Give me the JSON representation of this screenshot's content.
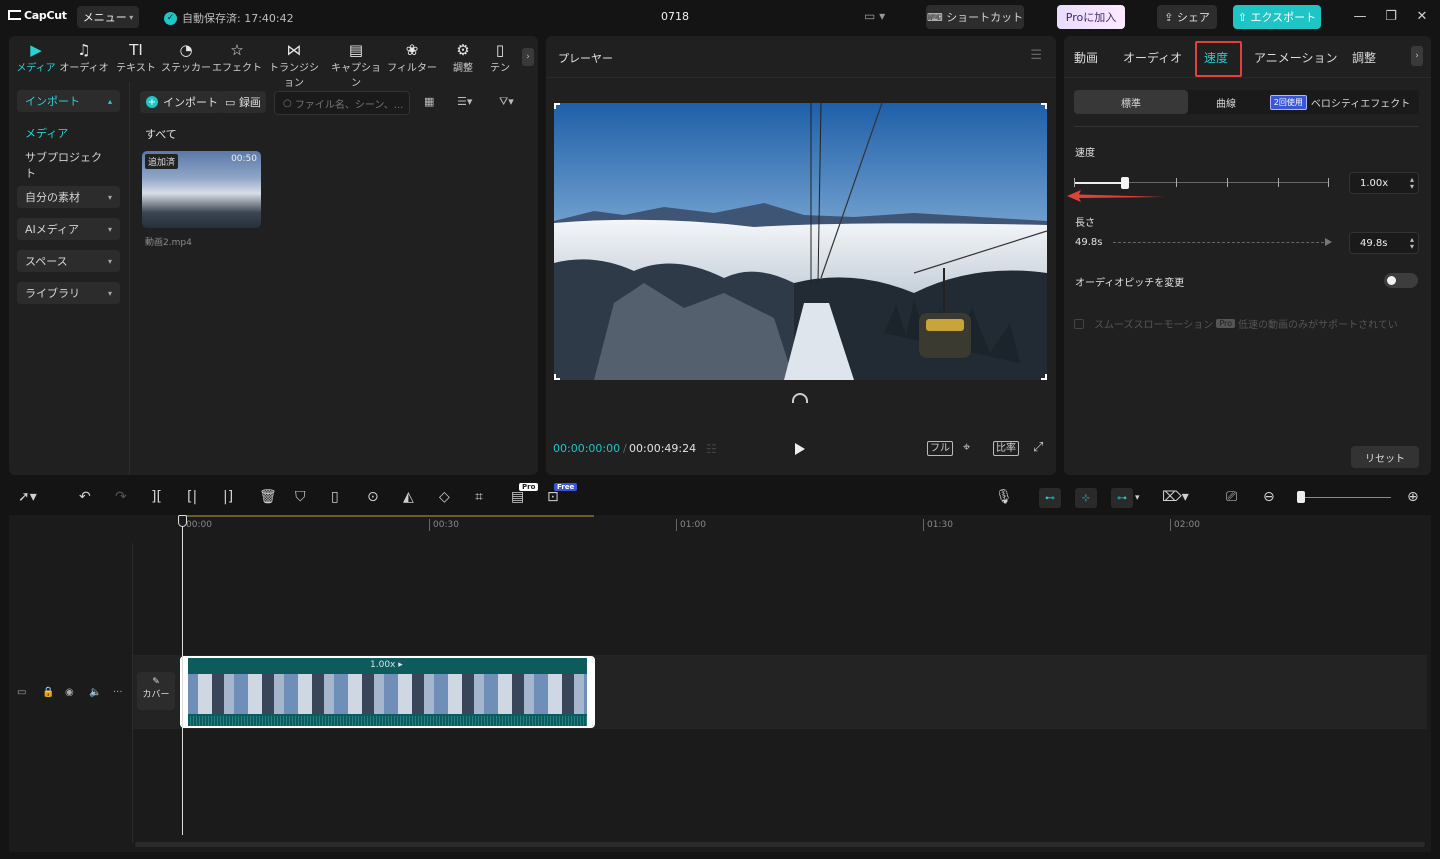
{
  "titlebar": {
    "app_name": "CapCut",
    "menu_label": "メニュー",
    "autosave": "自動保存済: 17:40:42",
    "project_title": "0718",
    "shortcut_label": "ショートカット",
    "pro_label": "Proに加入",
    "share_label": "シェア",
    "export_label": "エクスポート",
    "brand_color": "#1fc4c4"
  },
  "media_tabs": [
    {
      "label": "メディア",
      "icon": "media-icon",
      "active": true
    },
    {
      "label": "オーディオ",
      "icon": "audio-icon"
    },
    {
      "label": "テキスト",
      "icon": "text-icon"
    },
    {
      "label": "ステッカー",
      "icon": "sticker-icon"
    },
    {
      "label": "エフェクト",
      "icon": "effect-icon"
    },
    {
      "label": "トランジション",
      "icon": "transition-icon"
    },
    {
      "label": "キャプション",
      "icon": "caption-icon"
    },
    {
      "label": "フィルター",
      "icon": "filter-icon"
    },
    {
      "label": "調整",
      "icon": "adjust-icon"
    },
    {
      "label": "テン",
      "icon": "template-icon"
    }
  ],
  "media_sidebar": {
    "import": "インポート",
    "media": "メディア",
    "subproject": "サブプロジェクト",
    "my_assets": "自分の素材",
    "ai_media": "AIメディア",
    "space": "スペース",
    "library": "ライブラリ"
  },
  "media_toolbar": {
    "import_btn": "インポート",
    "record_btn": "録画",
    "search_placeholder": "ファイル名、シーン、..."
  },
  "media_content": {
    "filter_all": "すべて",
    "item": {
      "badge": "追加済",
      "duration": "00:50",
      "name": "動画2.mp4"
    }
  },
  "player": {
    "title": "プレーヤー",
    "current_time": "00:00:00:00",
    "total_time": "00:00:49:24",
    "full_label": "フル",
    "ratio_label": "比率"
  },
  "props_tabs": [
    {
      "label": "動画"
    },
    {
      "label": "オーディオ"
    },
    {
      "label": "速度",
      "active": true
    },
    {
      "label": "アニメーション"
    },
    {
      "label": "調整"
    }
  ],
  "speed": {
    "seg_standard": "標準",
    "seg_curve": "曲線",
    "used_badge": "2回使用",
    "seg_velocity": "ベロシティエフェクト",
    "speed_label": "速度",
    "speed_value": "1.00x",
    "speed_slider_fraction": 0.2,
    "length_label": "長さ",
    "length_left": "49.8s",
    "length_value": "49.8s",
    "pitch_label": "オーディオピッチを変更",
    "pitch_on": false,
    "smooth_label": "スムーズスローモーション",
    "smooth_pro": "Pro",
    "smooth_note": "低速の動画のみがサポートされてい",
    "reset_label": "リセット"
  },
  "timeline": {
    "pro_badge": "Pro",
    "free_badge": "Free",
    "ruler_marks": [
      "00:00",
      "00:30",
      "01:00",
      "01:30",
      "02:00"
    ],
    "cover_label": "カバー",
    "clip_speed": "1.00x"
  }
}
